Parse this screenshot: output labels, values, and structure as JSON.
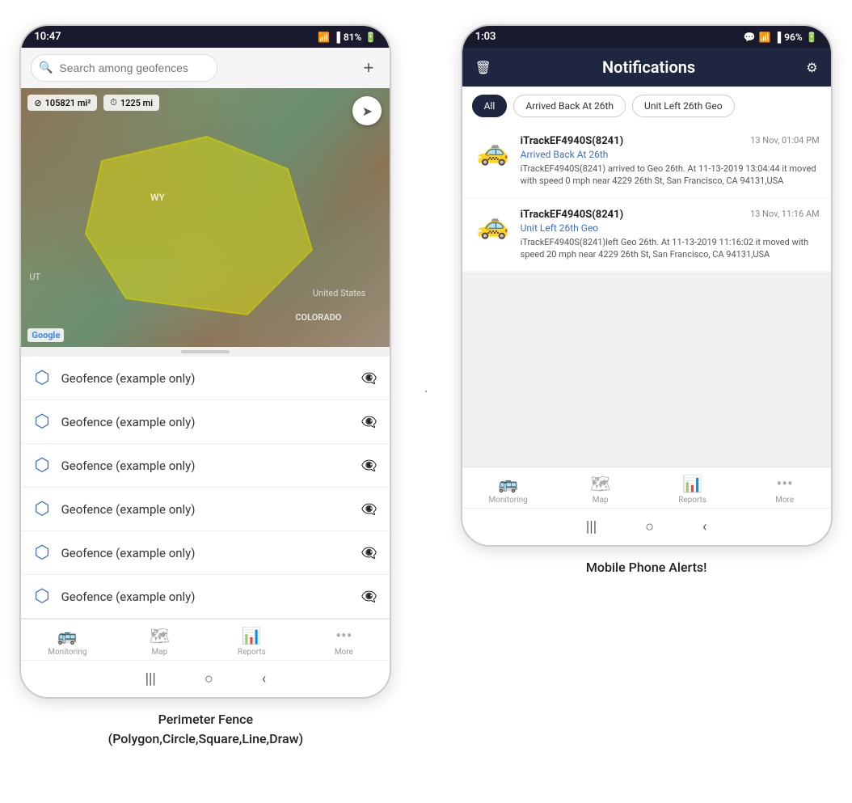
{
  "left_phone": {
    "status_bar": {
      "time": "10:47",
      "battery": "81%",
      "signal": "WiFi + cellular"
    },
    "search": {
      "placeholder": "Search among geofences"
    },
    "map": {
      "stat1": "105821 mi²",
      "stat2": "1225 mi",
      "label_wy": "WY",
      "label_colorado": "COLORADO",
      "label_us": "United States",
      "label_ut": "UT"
    },
    "geofences": [
      {
        "name": "Geofence (example only)"
      },
      {
        "name": "Geofence (example only)"
      },
      {
        "name": "Geofence (example only)"
      },
      {
        "name": "Geofence (example only)"
      },
      {
        "name": "Geofence (example only)"
      },
      {
        "name": "Geofence (example only)"
      }
    ],
    "nav": {
      "items": [
        {
          "label": "Monitoring",
          "icon": "🚌"
        },
        {
          "label": "Map",
          "icon": "🗺"
        },
        {
          "label": "Reports",
          "icon": "📊"
        },
        {
          "label": "More",
          "icon": "···"
        }
      ]
    },
    "caption": "Perimeter Fence\n(Polygon,Circle,Square,Line,Draw)"
  },
  "divider_dot": ".",
  "right_phone": {
    "status_bar": {
      "time": "1:03",
      "battery": "96%"
    },
    "header": {
      "title": "Notifications",
      "delete_icon": "🗑",
      "settings_icon": "⚙"
    },
    "filters": [
      {
        "label": "All",
        "active": true
      },
      {
        "label": "Arrived Back At 26th",
        "active": false
      },
      {
        "label": "Unit Left 26th Geo",
        "active": false
      }
    ],
    "notifications": [
      {
        "device": "iTrackEF4940S(8241)",
        "time": "13 Nov, 01:04 PM",
        "event": "Arrived Back At 26th",
        "description": "iTrackEF4940S(8241) arrived to Geo 26th.   At 11-13-2019 13:04:44 it moved with speed 0 mph near 4229 26th St, San Francisco, CA 94131,USA"
      },
      {
        "device": "iTrackEF4940S(8241)",
        "time": "13 Nov, 11:16 AM",
        "event": "Unit Left 26th Geo",
        "description": "iTrackEF4940S(8241)left Geo 26th.   At 11-13-2019 11:16:02 it moved with speed 20 mph near 4229 26th St, San Francisco, CA 94131,USA"
      }
    ],
    "nav": {
      "items": [
        {
          "label": "Monitoring",
          "icon": "🚌"
        },
        {
          "label": "Map",
          "icon": "🗺"
        },
        {
          "label": "Reports",
          "icon": "📊"
        },
        {
          "label": "More",
          "icon": "···"
        }
      ]
    },
    "caption": "Mobile Phone Alerts!"
  }
}
